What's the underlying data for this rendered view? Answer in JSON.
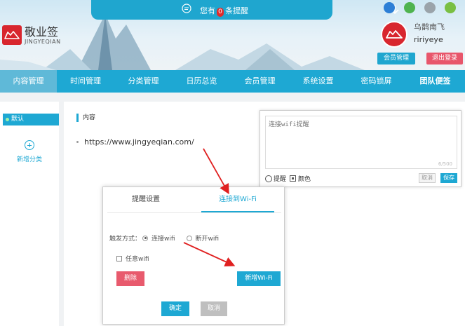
{
  "notice": {
    "prefix": "您有",
    "count": "0",
    "suffix": "条提醒"
  },
  "logo": {
    "name_cn": "敬业签",
    "name_en": "JINGYEQIAN"
  },
  "platform_icons": [
    "ie-icon",
    "windows-icon",
    "apple-icon",
    "android-icon"
  ],
  "user": {
    "display_name": "乌鹊南飞",
    "user_id": "ririyeye",
    "member_btn": "会员管理",
    "logout_btn": "退出登录"
  },
  "nav": {
    "items": [
      {
        "label": "内容管理"
      },
      {
        "label": "时间管理"
      },
      {
        "label": "分类管理"
      },
      {
        "label": "日历总览"
      },
      {
        "label": "会员管理"
      },
      {
        "label": "系统设置"
      },
      {
        "label": "密码锁屏"
      },
      {
        "label": "团队便签"
      }
    ]
  },
  "sidebar": {
    "default_label": "默认",
    "add_category": "新增分类"
  },
  "main": {
    "column_header": "内容",
    "item_url": "https://www.jingyeqian.com/"
  },
  "remind_panel": {
    "placeholder": "连接wifi提醒",
    "counter": "6/500",
    "remind_label": "提醒",
    "color_label": "颜色",
    "cancel": "取消",
    "save": "保存"
  },
  "dialog": {
    "tab_reminder": "提醒设置",
    "tab_wifi": "连接到Wi-Fi",
    "trigger_label": "触发方式：",
    "trigger_connect": "连接wifi",
    "trigger_disconnect": "断开wifi",
    "any_wifi": "任意wifi",
    "delete": "删除",
    "add_wifi": "新增Wi-Fi",
    "confirm": "确定",
    "cancel": "取消"
  },
  "colors": {
    "accent": "#1ea8d3",
    "danger": "#e85a6d",
    "brand": "#d8262e"
  }
}
